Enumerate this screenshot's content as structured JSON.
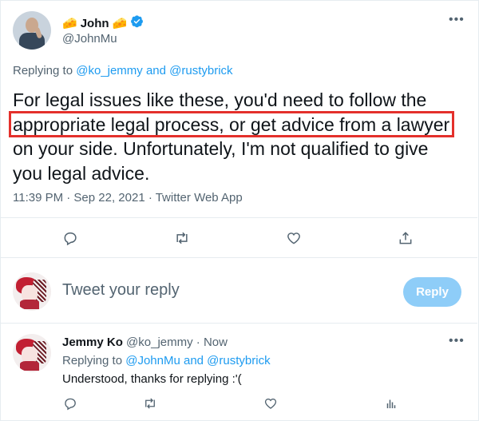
{
  "tweet": {
    "author_name": "John",
    "author_handle": "@JohnMu",
    "replying_prefix": "Replying to",
    "replying_to": "@ko_jemmy and @rustybrick",
    "text_lines": [
      "For legal issues like these, you'd need to follow the",
      "appropriate legal process, or get advice from a lawyer",
      "on your side. Unfortunately, I'm not qualified to give",
      "you legal advice."
    ],
    "meta": "11:39 PM · Sep 22, 2021 · Twitter Web App"
  },
  "composer": {
    "placeholder": "Tweet your reply",
    "reply_label": "Reply"
  },
  "reply": {
    "author_name": "Jemmy Ko",
    "author_handle": "@ko_jemmy",
    "separator": "·",
    "time": "Now",
    "replying_prefix": "Replying to",
    "replying_to": "@JohnMu and @rustybrick",
    "text": "Understood, thanks for replying :'("
  },
  "icons": {
    "more": "more-dots-icon",
    "verified": "verified-badge-icon",
    "badge_emoji": "🧀",
    "reply": "reply-bubble-icon",
    "retweet": "retweet-icon",
    "like": "heart-icon",
    "share": "share-icon",
    "analytics": "analytics-icon"
  },
  "colors": {
    "accent": "#1d9bf0",
    "reply_button": "#8ecdf8",
    "highlight_box": "#e4302b",
    "muted_text": "#536471"
  }
}
